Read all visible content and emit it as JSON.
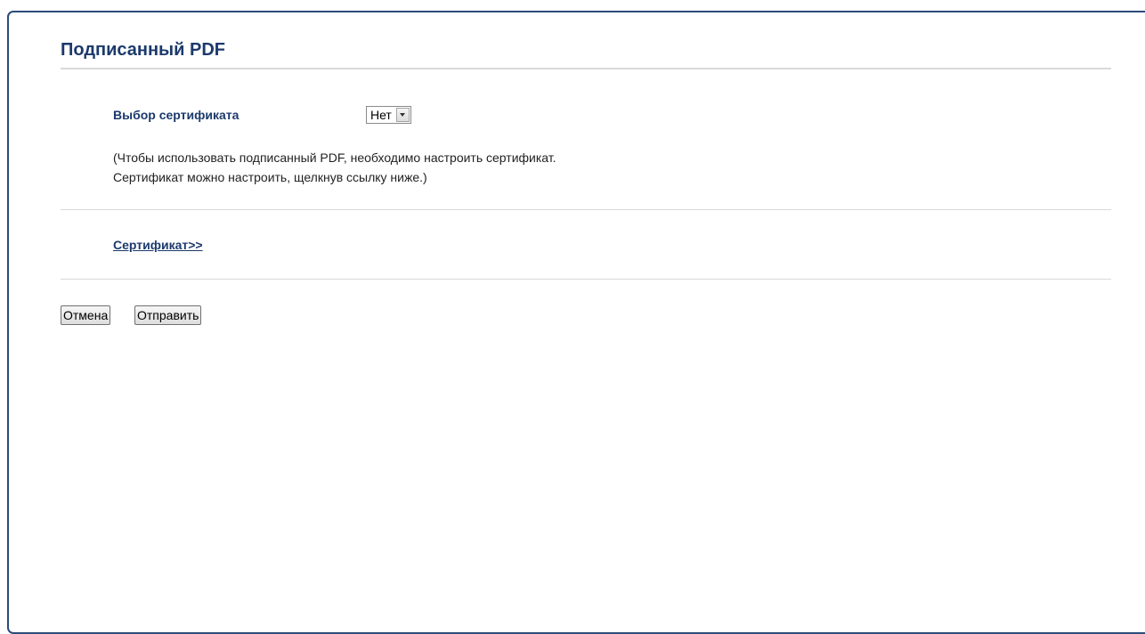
{
  "page": {
    "title": "Подписанный PDF"
  },
  "certificate_select": {
    "label": "Выбор сертификата",
    "selected": "Нет"
  },
  "note": {
    "line1": "(Чтобы использовать подписанный PDF, необходимо настроить сертификат.",
    "line2": "Сертификат можно настроить, щелкнув ссылку ниже.)"
  },
  "links": {
    "certificate": "Сертификат>>"
  },
  "buttons": {
    "cancel": "Отмена",
    "submit": "Отправить"
  },
  "colors": {
    "heading": "#1c3a6b",
    "frame_border": "#2b4b7a",
    "rule": "#d9d9d9"
  }
}
